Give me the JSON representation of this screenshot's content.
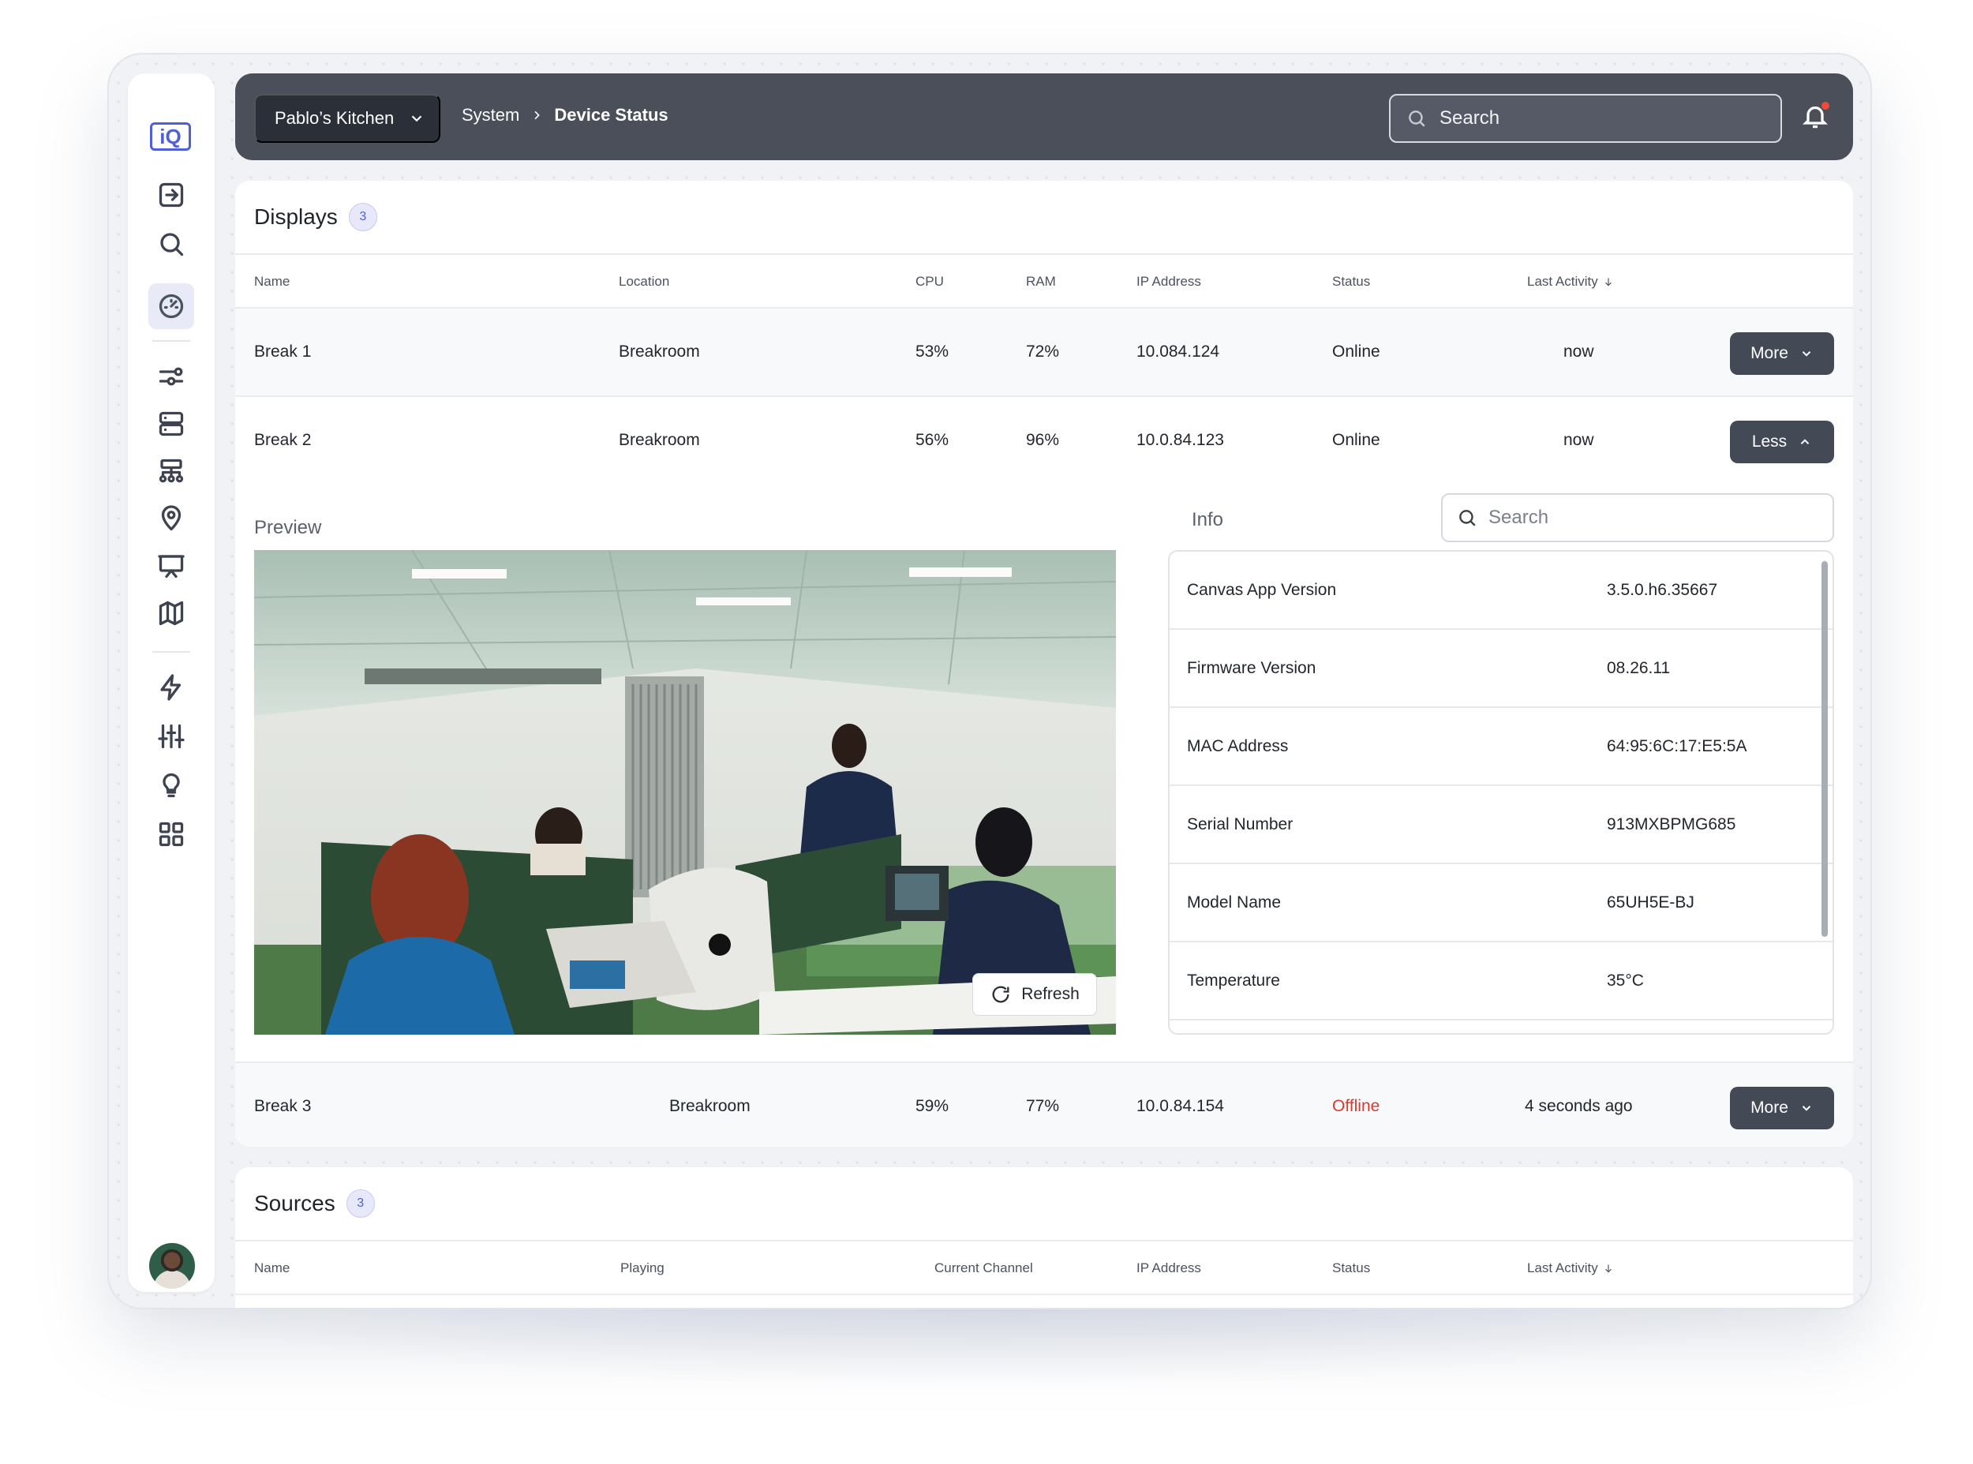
{
  "topbar": {
    "location": "Pablo’s Kitchen",
    "breadcrumb": [
      "System",
      "Device Status"
    ],
    "search_placeholder": "Search"
  },
  "sidebar": {
    "logo": "iQ",
    "icons": [
      "login-icon",
      "search-icon",
      "dashboard-icon",
      "sliders-icon",
      "server-icon",
      "network-icon",
      "location-pin-icon",
      "presentation-icon",
      "map-icon",
      "bolt-icon",
      "equalizer-icon",
      "lightbulb-icon",
      "apps-grid-icon"
    ],
    "active": "dashboard-icon"
  },
  "displays": {
    "title": "Displays",
    "count": "3",
    "columns": [
      "Name",
      "Location",
      "CPU",
      "RAM",
      "IP Address",
      "Status",
      "Last Activity"
    ],
    "rows": [
      {
        "name": "Break 1",
        "location": "Breakroom",
        "cpu": "53%",
        "ram": "72%",
        "ip": "10.084.124",
        "status": "Online",
        "last": "now",
        "button": "More"
      },
      {
        "name": "Break 2",
        "location": "Breakroom",
        "cpu": "56%",
        "ram": "96%",
        "ip": "10.0.84.123",
        "status": "Online",
        "last": "now",
        "button": "Less"
      },
      {
        "name": "Break 3",
        "location": "Breakroom",
        "cpu": "59%",
        "ram": "77%",
        "ip": "10.0.84.154",
        "status": "Offline",
        "last": "4 seconds ago",
        "button": "More"
      }
    ],
    "expanded": {
      "preview_label": "Preview",
      "refresh_label": "Refresh",
      "info_label": "Info",
      "info_search_placeholder": "Search",
      "info": [
        {
          "key": "Canvas App Version",
          "value": "3.5.0.h6.35667"
        },
        {
          "key": "Firmware Version",
          "value": "08.26.11"
        },
        {
          "key": "MAC Address",
          "value": "64:95:6C:17:E5:5A"
        },
        {
          "key": "Serial Number",
          "value": "913MXBPMG685"
        },
        {
          "key": "Model Name",
          "value": "65UH5E-BJ"
        },
        {
          "key": "Temperature",
          "value": "35°C"
        }
      ]
    }
  },
  "sources": {
    "title": "Sources",
    "count": "3",
    "columns": [
      "Name",
      "Playing",
      "Current Channel",
      "IP Address",
      "Status",
      "Last Activity"
    ]
  },
  "colors": {
    "topbar": "#4a4f5a",
    "button_dark": "#444a55",
    "accent": "#4f5fd8",
    "offline": "#d63b2f"
  }
}
